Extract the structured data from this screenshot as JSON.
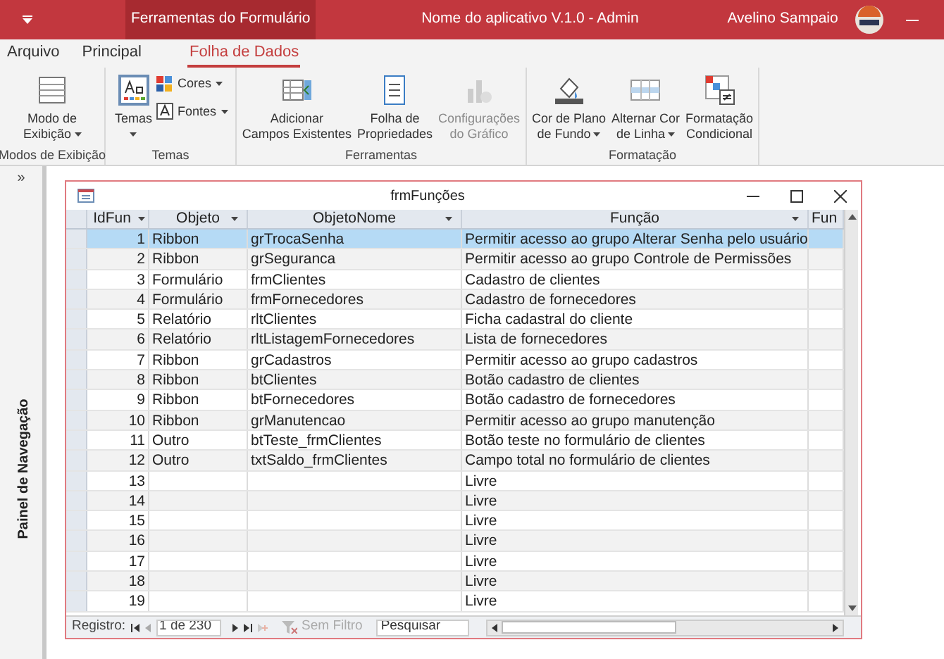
{
  "title_bar": {
    "context_tab": "Ferramentas do Formulário",
    "title": "Nome do aplicativo V.1.0 - Admin",
    "user": "Avelino Sampaio"
  },
  "ribbon_tabs": [
    {
      "label": "Arquivo",
      "selected": false
    },
    {
      "label": "Principal",
      "selected": false
    },
    {
      "label": "Folha de Dados",
      "selected": true
    }
  ],
  "ribbon_groups": [
    {
      "label": "Modos de Exibição",
      "buttons": [
        {
          "kind": "large",
          "label": [
            "Modo de",
            "Exibição"
          ],
          "dropdown": true,
          "disabled": false
        }
      ]
    },
    {
      "label": "Temas",
      "buttons": [
        {
          "kind": "large",
          "label": [
            "Temas"
          ],
          "dropdown": true,
          "disabled": false
        },
        {
          "kind": "small",
          "label": [
            "Cores"
          ],
          "dropdown": true,
          "disabled": false
        },
        {
          "kind": "small",
          "label": [
            "Fontes"
          ],
          "dropdown": true,
          "disabled": false
        }
      ]
    },
    {
      "label": "Ferramentas",
      "buttons": [
        {
          "kind": "large",
          "label": [
            "Adicionar",
            "Campos Existentes"
          ],
          "dropdown": false,
          "disabled": false
        },
        {
          "kind": "large",
          "label": [
            "Folha de",
            "Propriedades"
          ],
          "dropdown": false,
          "disabled": false
        },
        {
          "kind": "large",
          "label": [
            "Configurações",
            "do Gráfico"
          ],
          "dropdown": false,
          "disabled": true
        }
      ]
    },
    {
      "label": "Formatação",
      "buttons": [
        {
          "kind": "large",
          "label": [
            "Cor de Plano",
            "de Fundo"
          ],
          "dropdown": true,
          "disabled": false
        },
        {
          "kind": "large",
          "label": [
            "Alternar Cor",
            "de Linha"
          ],
          "dropdown": true,
          "disabled": false
        },
        {
          "kind": "large",
          "label": [
            "Formatação",
            "Condicional"
          ],
          "dropdown": false,
          "disabled": false
        }
      ]
    }
  ],
  "nav_pane": {
    "toggle": "»",
    "label": "Painel de Navegação"
  },
  "form": {
    "title": "frmFunções",
    "columns": [
      "IdFun",
      "Objeto",
      "ObjetoNome",
      "Função",
      "Fun"
    ],
    "rows": [
      {
        "cells": [
          "1",
          "Ribbon",
          "grTrocaSenha",
          "Permitir acesso ao grupo Alterar Senha pelo usuário"
        ],
        "selected": true
      },
      {
        "cells": [
          "2",
          "Ribbon",
          "grSeguranca",
          "Permitir acesso ao grupo Controle de Permissões"
        ],
        "selected": false
      },
      {
        "cells": [
          "3",
          "Formulário",
          "frmClientes",
          "Cadastro de clientes"
        ],
        "selected": false
      },
      {
        "cells": [
          "4",
          "Formulário",
          "frmFornecedores",
          "Cadastro de fornecedores"
        ],
        "selected": false
      },
      {
        "cells": [
          "5",
          "Relatório",
          "rltClientes",
          "Ficha cadastral do cliente"
        ],
        "selected": false
      },
      {
        "cells": [
          "6",
          "Relatório",
          "rltListagemFornecedores",
          "Lista de fornecedores"
        ],
        "selected": false
      },
      {
        "cells": [
          "7",
          "Ribbon",
          "grCadastros",
          "Permitir acesso ao grupo cadastros"
        ],
        "selected": false
      },
      {
        "cells": [
          "8",
          "Ribbon",
          "btClientes",
          "Botão cadastro de clientes"
        ],
        "selected": false
      },
      {
        "cells": [
          "9",
          "Ribbon",
          "btFornecedores",
          "Botão cadastro de fornecedores"
        ],
        "selected": false
      },
      {
        "cells": [
          "10",
          "Ribbon",
          "grManutencao",
          "Permitir acesso ao grupo manutenção"
        ],
        "selected": false
      },
      {
        "cells": [
          "11",
          "Outro",
          "btTeste_frmClientes",
          "Botão teste no formulário de clientes"
        ],
        "selected": false
      },
      {
        "cells": [
          "12",
          "Outro",
          "txtSaldo_frmClientes",
          "Campo total no formulário de clientes"
        ],
        "selected": false
      },
      {
        "cells": [
          "13",
          "",
          "",
          "Livre"
        ],
        "selected": false
      },
      {
        "cells": [
          "14",
          "",
          "",
          "Livre"
        ],
        "selected": false
      },
      {
        "cells": [
          "15",
          "",
          "",
          "Livre"
        ],
        "selected": false
      },
      {
        "cells": [
          "16",
          "",
          "",
          "Livre"
        ],
        "selected": false
      },
      {
        "cells": [
          "17",
          "",
          "",
          "Livre"
        ],
        "selected": false
      },
      {
        "cells": [
          "18",
          "",
          "",
          "Livre"
        ],
        "selected": false
      },
      {
        "cells": [
          "19",
          "",
          "",
          "Livre"
        ],
        "selected": false
      }
    ],
    "record_nav": {
      "label": "Registro:",
      "position": "1 de 230",
      "filter": {
        "label": "Sem Filtro",
        "disabled": true
      },
      "search_placeholder": "Pesquisar"
    }
  }
}
